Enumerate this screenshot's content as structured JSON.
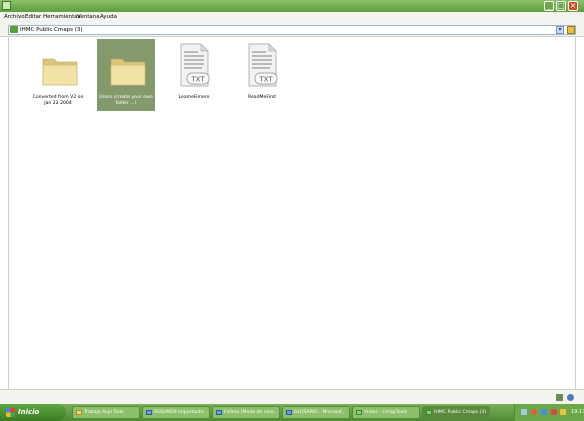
{
  "window": {
    "title": ""
  },
  "menu": [
    "Archivo",
    "Editar",
    "Herramientas",
    "Ventana",
    "Ayuda"
  ],
  "address": {
    "text": "IHMC Public Cmaps (3)"
  },
  "items": [
    {
      "label": "Converted from V2 on Jan 22 2004",
      "icon": "folder-icon",
      "selected": false
    },
    {
      "label": "Users (create your own folder ...)",
      "icon": "folder-icon",
      "selected": true
    },
    {
      "label": "LeameFimero",
      "icon": "txt-file-icon",
      "selected": false
    },
    {
      "label": "ReadMeFirst",
      "icon": "txt-file-icon",
      "selected": false
    }
  ],
  "txt_badge": "TXT",
  "taskbar": {
    "start_label": "Inicio",
    "tasks": [
      {
        "label": "Trabajo Aspi Todo",
        "active": false
      },
      {
        "label": "RESUMEN importante ...",
        "active": false
      },
      {
        "label": "Folleto [Modo de com...",
        "active": false
      },
      {
        "label": "GLOSARIO - Microsof...",
        "active": false
      },
      {
        "label": "Vistas - CmapTools",
        "active": false
      },
      {
        "label": "IHMC Public Cmaps (3)",
        "active": true
      }
    ],
    "clock": "19:17"
  },
  "colors": {
    "selection": "#859a6c",
    "titlebar": "#6aa84a",
    "taskbar": "#5e9e3e"
  }
}
